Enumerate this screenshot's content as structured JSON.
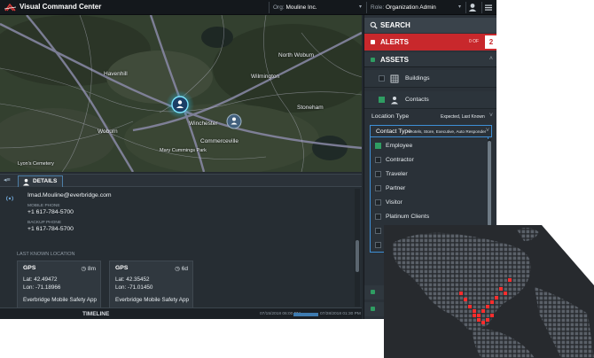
{
  "app": {
    "title": "Visual Command Center",
    "org_label": "Org:",
    "org_value": "Mouline Inc.",
    "role_label": "Role:",
    "role_value": "Organization Admin"
  },
  "icons": {
    "logo": "everbridge-logo-icon",
    "user": "user-icon",
    "menu": "hamburger-menu-icon",
    "search": "search-icon",
    "building": "building-icon",
    "contact": "person-icon",
    "clock": "clock-icon"
  },
  "colors": {
    "alert_red": "#c8282c",
    "check_green": "#2f9d62",
    "focus_blue": "#3e8fd6",
    "heat_red": "#ff2d2d"
  },
  "map": {
    "places": [
      "Havenhill",
      "North Wobum",
      "Wilmington",
      "Winchester",
      "Stoneham",
      "Woburn",
      "Commerceville",
      "Lyon's Cemetery",
      "Mary Cummings Park"
    ]
  },
  "details": {
    "tab_label": "DETAILS",
    "email": "Imad.Mouline@everbridge.com",
    "mobile_label": "MOBILE PHONE",
    "mobile_value": "+1 617-784-5700",
    "backup_label": "BACKUP PHONE",
    "backup_value": "+1 617-784-5700",
    "last_known_heading": "LAST KNOWN LOCATION",
    "cards": [
      {
        "title": "GPS",
        "age": "8m",
        "line1": "Lat: 42.49472",
        "line2": "Lon: -71.18966",
        "line3": "Everbridge Mobile Safety App"
      },
      {
        "title": "GPS",
        "age": "6d",
        "line1": "Lat: 42.35452",
        "line2": "Lon: -71.01450",
        "line3": "Everbridge Mobile Safety App"
      }
    ],
    "timeline_label": "TIMELINE",
    "timeline_start": "07/15/2018 06:00 PM",
    "timeline_end": "07/28/2018 01:30 PM"
  },
  "panel": {
    "search_label": "SEARCH",
    "alerts_label": "ALERTS",
    "alerts_count": "0 OF",
    "alerts_badge": "2",
    "assets_label": "ASSETS",
    "layers": [
      {
        "label": "Buildings",
        "checked": false
      },
      {
        "label": "Contacts",
        "checked": true
      }
    ],
    "location_type_label": "Location Type",
    "location_type_value": "Expected, Last Known",
    "contact_type_label": "Contact Type",
    "contact_type_value": "Hotels, Store, Executive, Auto Responder",
    "contact_options": [
      {
        "label": "Employee",
        "checked": true
      },
      {
        "label": "Contractor",
        "checked": false
      },
      {
        "label": "Traveler",
        "checked": false
      },
      {
        "label": "Partner",
        "checked": false
      },
      {
        "label": "Visitor",
        "checked": false
      },
      {
        "label": "Platinum Clients",
        "checked": false
      }
    ]
  }
}
